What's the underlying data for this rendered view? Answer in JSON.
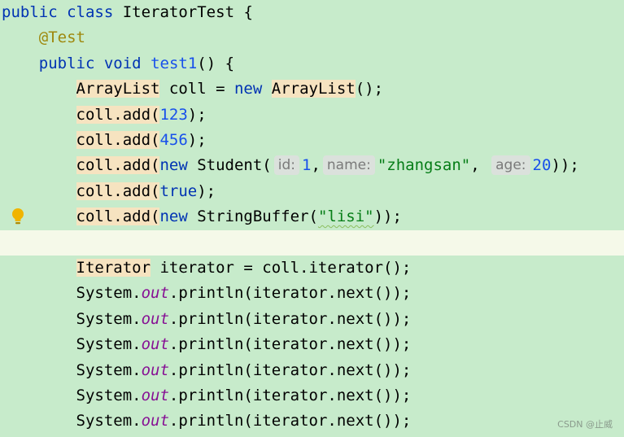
{
  "editor": {
    "lines": [
      {
        "indent": "",
        "tokens": [
          {
            "t": "public",
            "c": "kw"
          },
          {
            "t": " "
          },
          {
            "t": "class",
            "c": "kw"
          },
          {
            "t": " IteratorTest {"
          }
        ]
      },
      {
        "indent": "    ",
        "tokens": [
          {
            "t": "@Test",
            "c": "ann"
          }
        ]
      },
      {
        "indent": "    ",
        "tokens": [
          {
            "t": "public",
            "c": "kw"
          },
          {
            "t": " "
          },
          {
            "t": "void",
            "c": "kw"
          },
          {
            "t": " "
          },
          {
            "t": "test1",
            "c": "num"
          },
          {
            "t": "() {"
          }
        ]
      },
      {
        "indent": "        ",
        "tokens": [
          {
            "t": "ArrayList",
            "c": "type-hl"
          },
          {
            "t": " coll = "
          },
          {
            "t": "new",
            "c": "kw"
          },
          {
            "t": " "
          },
          {
            "t": "ArrayList",
            "c": "type-hl"
          },
          {
            "t": "();"
          }
        ]
      },
      {
        "indent": "        ",
        "tokens": [
          {
            "t": "coll.add(",
            "c": "type-hl"
          },
          {
            "t": "123",
            "c": "num"
          },
          {
            "t": ");"
          }
        ]
      },
      {
        "indent": "        ",
        "tokens": [
          {
            "t": "coll.add(",
            "c": "type-hl"
          },
          {
            "t": "456",
            "c": "num"
          },
          {
            "t": ");"
          }
        ]
      },
      {
        "indent": "        ",
        "tokens": [
          {
            "t": "coll.add(",
            "c": "type-hl"
          },
          {
            "t": "new",
            "c": "kw"
          },
          {
            "t": " Student("
          },
          {
            "t": "id:",
            "c": "hint"
          },
          {
            "t": "1",
            "c": "num"
          },
          {
            "t": ","
          },
          {
            "t": "name:",
            "c": "hint"
          },
          {
            "t": "\"zhangsan\"",
            "c": "str"
          },
          {
            "t": ", "
          },
          {
            "t": "age:",
            "c": "hint"
          },
          {
            "t": "20",
            "c": "num"
          },
          {
            "t": "));"
          }
        ]
      },
      {
        "indent": "        ",
        "tokens": [
          {
            "t": "coll.add(",
            "c": "type-hl"
          },
          {
            "t": "true",
            "c": "kw"
          },
          {
            "t": ");"
          }
        ]
      },
      {
        "indent": "        ",
        "tokens": [
          {
            "t": "coll.add(",
            "c": "type-hl"
          },
          {
            "t": "new",
            "c": "kw"
          },
          {
            "t": " StringBuffer("
          },
          {
            "t": "\"lisi\"",
            "c": "str squiggle"
          },
          {
            "t": "));"
          }
        ]
      },
      {
        "indent": "",
        "tokens": [],
        "current": true
      },
      {
        "indent": "        ",
        "tokens": [
          {
            "t": "Iterator",
            "c": "type-hl"
          },
          {
            "t": " iterator = coll.iterator();"
          }
        ]
      },
      {
        "indent": "        ",
        "tokens": [
          {
            "t": "System."
          },
          {
            "t": "out",
            "c": "field"
          },
          {
            "t": ".println(iterator.next());"
          }
        ]
      },
      {
        "indent": "        ",
        "tokens": [
          {
            "t": "System."
          },
          {
            "t": "out",
            "c": "field"
          },
          {
            "t": ".println(iterator.next());"
          }
        ]
      },
      {
        "indent": "        ",
        "tokens": [
          {
            "t": "System."
          },
          {
            "t": "out",
            "c": "field"
          },
          {
            "t": ".println(iterator.next());"
          }
        ]
      },
      {
        "indent": "        ",
        "tokens": [
          {
            "t": "System."
          },
          {
            "t": "out",
            "c": "field"
          },
          {
            "t": ".println(iterator.next());"
          }
        ]
      },
      {
        "indent": "        ",
        "tokens": [
          {
            "t": "System."
          },
          {
            "t": "out",
            "c": "field"
          },
          {
            "t": ".println(iterator.next());"
          }
        ]
      },
      {
        "indent": "        ",
        "tokens": [
          {
            "t": "System."
          },
          {
            "t": "out",
            "c": "field"
          },
          {
            "t": ".println(iterator.next());"
          }
        ]
      }
    ],
    "gutter_icons": [
      {
        "line": 8,
        "icon": "lightbulb-icon",
        "color": "#f0b400"
      }
    ]
  },
  "watermark": "CSDN @止威",
  "colors": {
    "background": "#c7ebcb",
    "current_line": "#f5f9e9",
    "keyword": "#0033b3",
    "annotation": "#9e880d",
    "number": "#1750eb",
    "string": "#067d17",
    "static_field": "#871094",
    "type_highlight": "#f6e3c0",
    "inlay_hint_bg": "#dbe1dc"
  }
}
